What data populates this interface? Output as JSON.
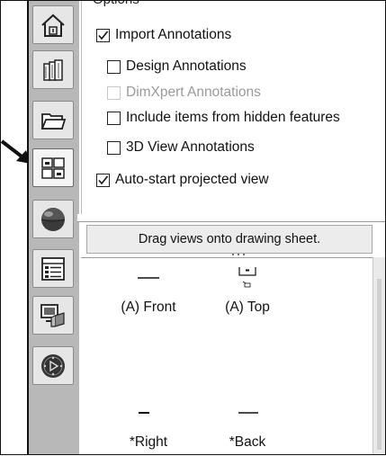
{
  "sidebar": {
    "items": [
      {
        "name": "home-icon"
      },
      {
        "name": "design-library-icon"
      },
      {
        "name": "file-explorer-icon"
      },
      {
        "name": "view-palette-icon",
        "active": true
      },
      {
        "name": "appearances-icon"
      },
      {
        "name": "custom-properties-icon"
      },
      {
        "name": "solidworks-resources-icon"
      },
      {
        "name": "forum-icon"
      }
    ]
  },
  "options": {
    "title": "Options",
    "import_annotations": {
      "label": "Import Annotations",
      "checked": true
    },
    "design_annotations": {
      "label": "Design Annotations",
      "checked": false
    },
    "dimxpert_annotations": {
      "label": "DimXpert Annotations",
      "checked": false,
      "disabled": true
    },
    "hidden_features": {
      "label": "Include items from hidden features",
      "checked": false
    },
    "view_3d_annotations": {
      "label": "3D View Annotations",
      "checked": false
    },
    "auto_start": {
      "label": "Auto-start projected view",
      "checked": true
    }
  },
  "banner": {
    "text": "Drag views onto drawing sheet."
  },
  "views": [
    {
      "label": "(A) Front"
    },
    {
      "label": "(A) Top"
    },
    {
      "label": "*Right"
    },
    {
      "label": "*Back"
    }
  ],
  "colors": {
    "sidebar": "#b8b8b8",
    "button": "#e6e6e6",
    "accent": "#111111"
  }
}
